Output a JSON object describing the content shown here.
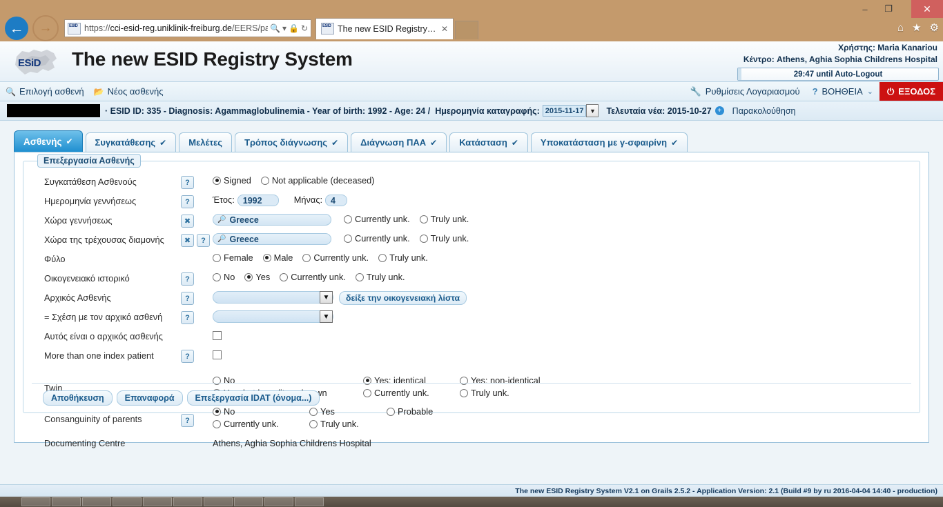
{
  "browser": {
    "url_prefix": "https://",
    "url_host": "cci-esid-reg.uniklinik-freiburg.de",
    "url_path": "/EERS/pati",
    "tab_title": "The new ESID Registry Syste...",
    "back_icon": "back-arrow-icon",
    "forward_icon": "forward-arrow-icon",
    "search_icon": "search-icon",
    "lock_icon": "lock-icon",
    "refresh_icon": "refresh-icon",
    "minimize_label": "–",
    "maximize_label": "❐",
    "close_label": "✕",
    "home_icon": "⌂",
    "fav_icon": "★",
    "gear_icon": "⚙"
  },
  "header": {
    "app_title": "The new ESID Registry System",
    "user_label": "Χρήστης:",
    "user_name": "Maria Kanariou",
    "centre_label": "Κέντρο:",
    "centre_name": "Athens, Aghia Sophia Childrens Hospital",
    "timer": "29:47 until Auto-Logout"
  },
  "menu": {
    "left": [
      {
        "icon": "search-icon",
        "label": "Επιλογή ασθενή"
      },
      {
        "icon": "folder-icon",
        "label": "Νέος ασθενής"
      }
    ],
    "account_icon": "wrench-icon",
    "account_label": "Ρυθμίσεις Λογαριασμού",
    "help_icon": "?",
    "help_label": "ΒΟΗΘΕΙΑ",
    "help_caret": "⌄",
    "logout_icon": "⏻",
    "logout_label": "ΕΞΟΔΟΣ"
  },
  "patient_bar": {
    "name_redacted": "",
    "summary": "· ESID ID: 335 - Diagnosis: Agammaglobulinemia - Year of birth: 1992 - Age: 24   /",
    "record_date_label": "Ημερομηνία καταγραφής:",
    "record_date_value": "2015-11-17",
    "last_news_label": "Τελευταία νέα: 2015-10-27",
    "follow_up_label": "Παρακολούθηση",
    "plus_icon": "+"
  },
  "tabs": [
    {
      "label": "Ασθενής",
      "check": "✔",
      "active": true
    },
    {
      "label": "Συγκατάθεσης",
      "check": "✔",
      "active": false
    },
    {
      "label": "Μελέτες",
      "check": "",
      "active": false
    },
    {
      "label": "Τρόπος διάγνωσης",
      "check": "✔",
      "active": false
    },
    {
      "label": "Διάγνωση ΠΑΑ",
      "check": "✔",
      "active": false
    },
    {
      "label": "Κατάσταση",
      "check": "✔",
      "active": false
    },
    {
      "label": "Υποκατάσταση με γ-σφαιρίνη",
      "check": "✔",
      "active": false
    }
  ],
  "form": {
    "legend": "Επεξεργασία Ασθενής",
    "consent": {
      "label": "Συγκατάθεση Ασθενούς",
      "options": [
        "Signed",
        "Not applicable (deceased)"
      ],
      "selected": "Signed"
    },
    "birthdate": {
      "label": "Ημερομηνία γεννήσεως",
      "year_label": "Έτος:",
      "year_value": "1992",
      "month_label": "Μήνας:",
      "month_value": "4"
    },
    "country_birth": {
      "label": "Χώρα γεννήσεως",
      "value": "Greece",
      "options": [
        "Currently unk.",
        "Truly unk."
      ]
    },
    "country_residence": {
      "label": "Χώρα της τρέχουσας διαμονής",
      "value": "Greece",
      "options": [
        "Currently unk.",
        "Truly unk."
      ]
    },
    "sex": {
      "label": "Φύλο",
      "options": [
        "Female",
        "Male",
        "Currently unk.",
        "Truly unk."
      ],
      "selected": "Male"
    },
    "family_history": {
      "label": "Οικογενειακό ιστορικό",
      "options": [
        "No",
        "Yes",
        "Currently unk.",
        "Truly unk."
      ],
      "selected": "Yes"
    },
    "index_patient": {
      "label": "Αρχικός Ασθενής",
      "value": "",
      "button": "δείξε την οικογενειακή λίστα"
    },
    "relation": {
      "label": "= Σχέση με τον αρχικό ασθενή",
      "value": ""
    },
    "is_index": {
      "label": "Αυτός είναι ο αρχικός ασθενής",
      "checked": false
    },
    "more_than_one_index": {
      "label": "More than one index patient",
      "checked": false
    },
    "twin": {
      "label": "Twin",
      "options": [
        "No",
        "Yes: identical",
        "Yes: non-identical",
        "Yes, but heredity unknown",
        "Currently unk.",
        "Truly unk."
      ],
      "selected": "Yes: identical"
    },
    "consanguinity": {
      "label": "Consanguinity of parents",
      "options": [
        "No",
        "Yes",
        "Probable",
        "Currently unk.",
        "Truly unk."
      ],
      "selected": "No"
    },
    "documenting_centre": {
      "label": "Documenting Centre",
      "value": "Athens, Aghia Sophia Childrens Hospital"
    },
    "help_icon": "?",
    "clear_icon": "✖",
    "buttons": [
      "Αποθήκευση",
      "Επαναφορά",
      "Επεξεργασία IDAT (όνομα...)"
    ]
  },
  "footer": {
    "text": "The new ESID Registry System V2.1 on Grails 2.5.2 - Application Version: 2.1 (Build #9 by ru 2016-04-04 14:40 - production)"
  },
  "colors": {
    "accent": "#1f8fd0",
    "logout_red": "#cc1111",
    "link_blue": "#1a5b8c",
    "chrome_tan": "#c49a6c"
  }
}
